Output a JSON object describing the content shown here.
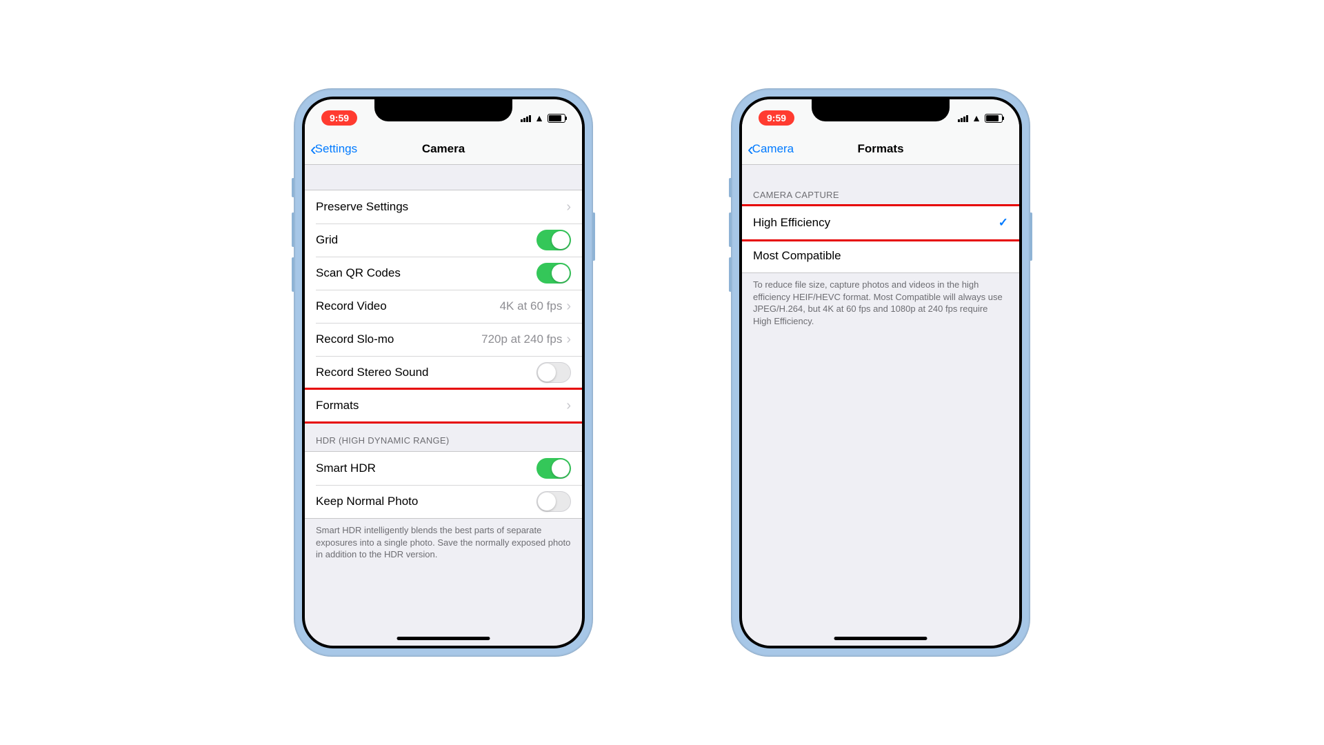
{
  "statusBar": {
    "time": "9:59"
  },
  "phone1": {
    "nav": {
      "back": "Settings",
      "title": "Camera"
    },
    "rows": {
      "preserve": "Preserve Settings",
      "grid": "Grid",
      "scanQR": "Scan QR Codes",
      "recordVideo": {
        "label": "Record Video",
        "value": "4K at 60 fps"
      },
      "recordSlomo": {
        "label": "Record Slo-mo",
        "value": "720p at 240 fps"
      },
      "stereo": "Record Stereo Sound",
      "formats": "Formats"
    },
    "hdr": {
      "header": "HDR (HIGH DYNAMIC RANGE)",
      "smartHDR": "Smart HDR",
      "keepNormal": "Keep Normal Photo",
      "footer": "Smart HDR intelligently blends the best parts of separate exposures into a single photo. Save the normally exposed photo in addition to the HDR version."
    }
  },
  "phone2": {
    "nav": {
      "back": "Camera",
      "title": "Formats"
    },
    "section": {
      "header": "CAMERA CAPTURE",
      "highEff": "High Efficiency",
      "mostCompat": "Most Compatible",
      "footer": "To reduce file size, capture photos and videos in the high efficiency HEIF/HEVC format. Most Compatible will always use JPEG/H.264, but 4K at 60 fps and 1080p at 240 fps require High Efficiency."
    }
  }
}
